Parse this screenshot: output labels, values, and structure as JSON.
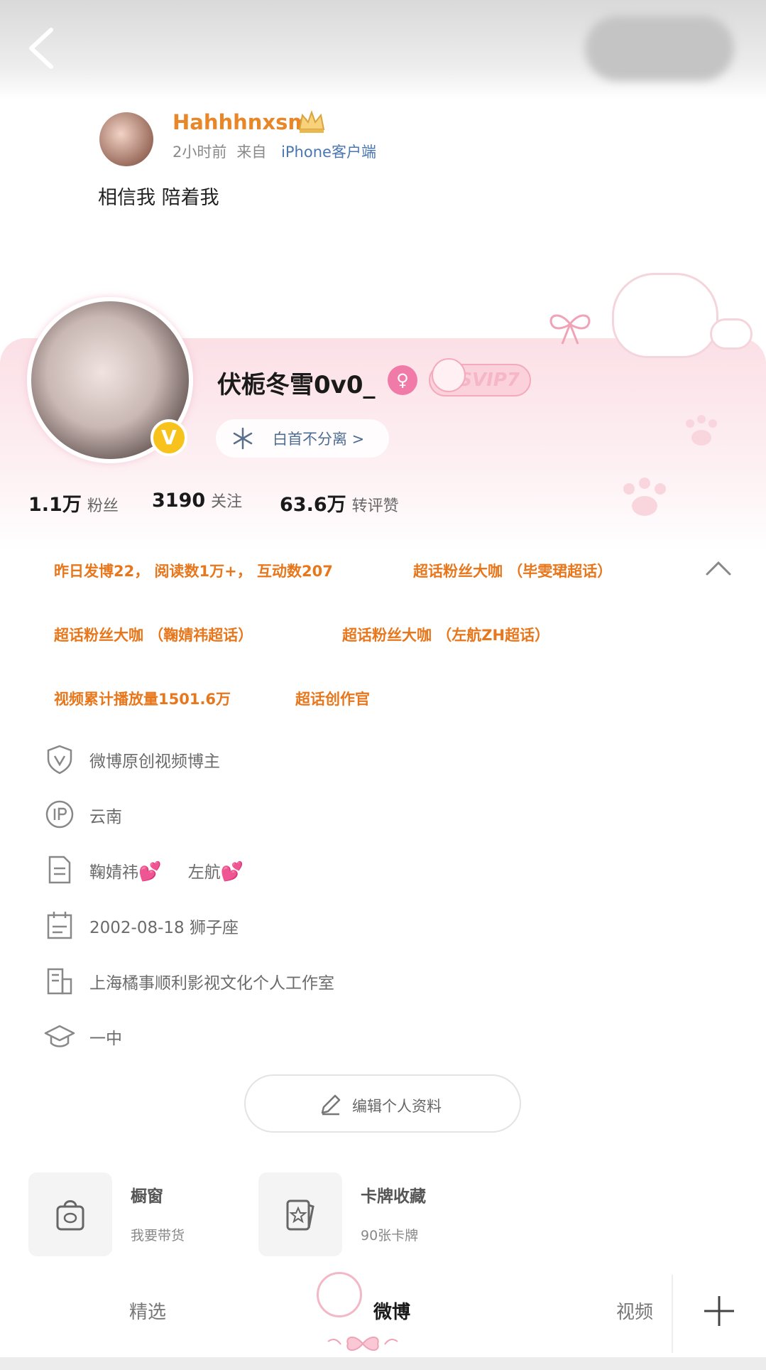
{
  "post": {
    "username": "Hahhhnxsm",
    "time": "2小时前",
    "from_label": "来自",
    "source": "iPhone客户端",
    "text": "相信我 陪着我"
  },
  "profile": {
    "nickname": "伏栀冬雪0v0_",
    "svip": "SVIP7",
    "tag": "白首不分离 >",
    "verified_mark": "V",
    "gender_symbol": "♀",
    "stats": [
      {
        "value": "1.1万",
        "label": "粉丝"
      },
      {
        "value": "3190",
        "label": "关注"
      },
      {
        "value": "63.6万",
        "label": "转评赞"
      }
    ]
  },
  "honors": [
    "昨日发博22， 阅读数1万+， 互动数207",
    "超话粉丝大咖 （毕雯珺超话）",
    "超话粉丝大咖 （鞠婧祎超话）",
    "超话粉丝大咖 （左航ZH超话）",
    "视频累计播放量1501.6万",
    "超话创作官"
  ],
  "info": {
    "verification": "微博原创视频博主",
    "ip": "云南",
    "bio_1": "鞠婧祎",
    "bio_2": "左航",
    "heart": "💕",
    "birthday": "2002-08-18  狮子座",
    "company": "上海橘事顺利影视文化个人工作室",
    "school": "一中"
  },
  "edit_button": "编辑个人资料",
  "cards": [
    {
      "title": "橱窗",
      "sub": "我要带货",
      "icon": "bag-icon"
    },
    {
      "title": "卡牌收藏",
      "sub": "90张卡牌",
      "icon": "card-collection-icon"
    }
  ],
  "tabs": {
    "featured": "精选",
    "weibo": "微博",
    "video": "视频"
  },
  "colors": {
    "accent_orange": "#e8771c",
    "username_orange": "#e8862a",
    "link_blue": "#4a77b0",
    "pink": "#f07aa8"
  }
}
